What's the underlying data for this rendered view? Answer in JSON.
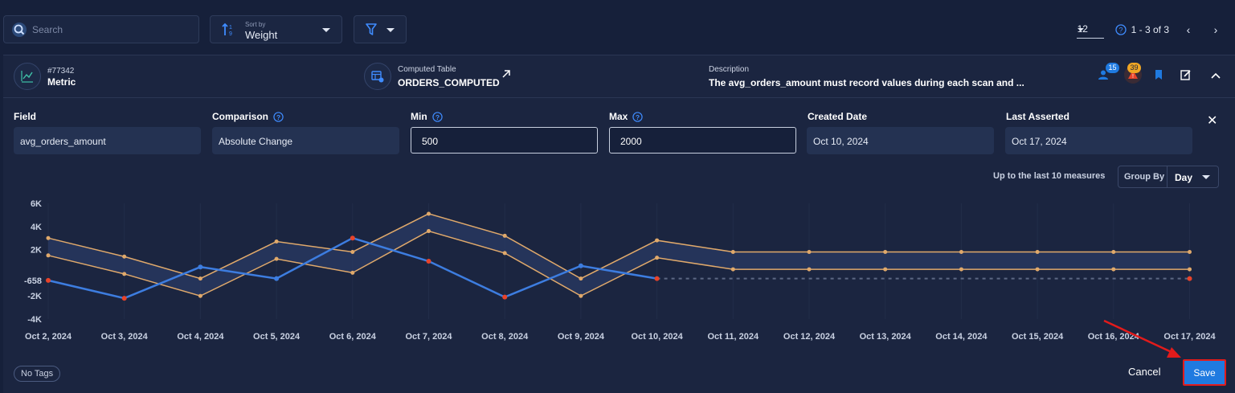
{
  "toolbar": {
    "search_placeholder": "Search",
    "sort_caption": "Sort by",
    "sort_value": "Weight",
    "page_size": "12",
    "page_range": "1 - 3 of 3"
  },
  "card": {
    "metric_id": "#77342",
    "metric_type": "Metric",
    "computed_label": "Computed Table",
    "computed_value": "ORDERS_COMPUTED",
    "description_label": "Description",
    "description_value": "The avg_orders_amount must record values during each scan and ...",
    "badge_users": "15",
    "badge_alerts": "39"
  },
  "fields": {
    "field_label": "Field",
    "field_value": "avg_orders_amount",
    "comparison_label": "Comparison",
    "comparison_value": "Absolute Change",
    "min_label": "Min",
    "min_value": "500",
    "max_label": "Max",
    "max_value": "2000",
    "created_label": "Created Date",
    "created_value": "Oct 10, 2024",
    "asserted_label": "Last Asserted",
    "asserted_value": "Oct 17, 2024"
  },
  "chart_controls": {
    "measures_label": "Up to the last 10 measures",
    "group_by_label": "Group By",
    "group_by_value": "Day"
  },
  "footer": {
    "tags": "No Tags",
    "cancel": "Cancel",
    "save": "Save"
  },
  "colors": {
    "accent": "#1f7ae0",
    "series_blue": "#3d7de0",
    "band": "#e0a96b",
    "anomaly": "#e8432a",
    "highlight": "#e21b1b"
  },
  "chart_data": {
    "type": "line",
    "x": [
      "Oct 2, 2024",
      "Oct 3, 2024",
      "Oct 4, 2024",
      "Oct 5, 2024",
      "Oct 6, 2024",
      "Oct 7, 2024",
      "Oct 8, 2024",
      "Oct 9, 2024",
      "Oct 10, 2024",
      "Oct 11, 2024",
      "Oct 12, 2024",
      "Oct 13, 2024",
      "Oct 14, 2024",
      "Oct 15, 2024",
      "Oct 16, 2024",
      "Oct 17, 2024"
    ],
    "y_ticks": [
      6000,
      4000,
      2000,
      -658,
      -2000,
      -4000
    ],
    "y_tick_labels": [
      "6K",
      "4K",
      "2K",
      "-658",
      "-2K",
      "-4K"
    ],
    "ylim": [
      -4000,
      6000
    ],
    "series": [
      {
        "values": [
          -658,
          -2200,
          500,
          -500,
          3000,
          1000,
          -2100,
          600,
          -500,
          null,
          null,
          null,
          null,
          null,
          null,
          -500
        ]
      },
      {
        "values": [
          3000,
          1400,
          -500,
          2700,
          1800,
          5100,
          3200,
          -500,
          2800,
          1800,
          1800,
          1800,
          1800,
          1800,
          1800,
          1800
        ]
      },
      {
        "values": [
          1500,
          -100,
          -2000,
          1200,
          0,
          3600,
          1700,
          -2000,
          1300,
          300,
          300,
          300,
          300,
          300,
          300,
          300
        ]
      }
    ],
    "anomalies": [
      0,
      1,
      4,
      5,
      6,
      8,
      15
    ],
    "grid": true
  }
}
